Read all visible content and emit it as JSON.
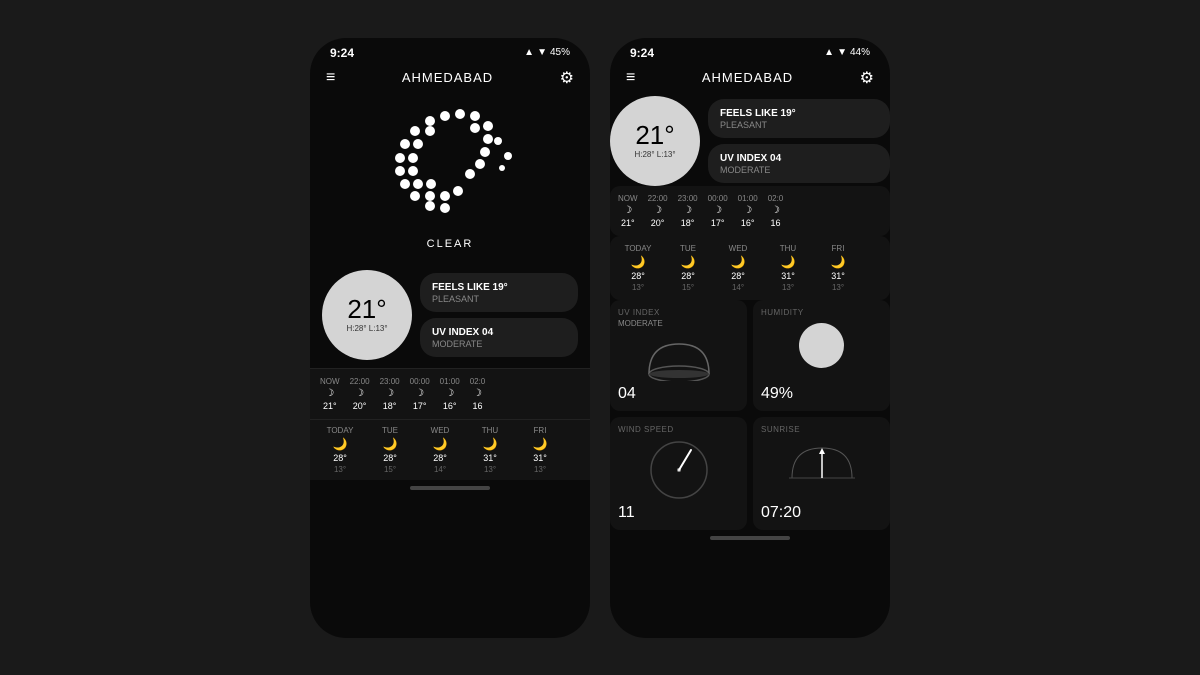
{
  "phone1": {
    "statusBar": {
      "time": "9:24",
      "battery": "45%"
    },
    "nav": {
      "title": "AHMEDABAD"
    },
    "weather": {
      "condition": "CLEAR",
      "temperature": "21°",
      "highLow": "H:28° L:13°",
      "feelsLike": "FEELS LIKE 19°",
      "feelsLikeSub": "PLEASANT",
      "uvIndex": "UV INDEX 04",
      "uvIndexSub": "MODERATE"
    },
    "hourly": [
      {
        "time": "NOW",
        "icon": "☽",
        "temp": "21°"
      },
      {
        "time": "22:00",
        "icon": "☽",
        "temp": "20°"
      },
      {
        "time": "23:00",
        "icon": "☽",
        "temp": "18°"
      },
      {
        "time": "00:00",
        "icon": "☽",
        "temp": "17°"
      },
      {
        "time": "01:00",
        "icon": "☽",
        "temp": "16°"
      },
      {
        "time": "02:0",
        "icon": "☽",
        "temp": "16"
      }
    ],
    "daily": [
      {
        "day": "TODAY",
        "icon": "🌙",
        "high": "28°",
        "low": "13°"
      },
      {
        "day": "TUE",
        "icon": "🌙",
        "high": "28°",
        "low": "15°"
      },
      {
        "day": "WED",
        "icon": "🌙",
        "high": "28°",
        "low": "14°"
      },
      {
        "day": "THU",
        "icon": "🌙",
        "high": "31°",
        "low": "13°"
      },
      {
        "day": "FRI",
        "icon": "🌙",
        "high": "31°",
        "low": "13°"
      }
    ]
  },
  "phone2": {
    "statusBar": {
      "time": "9:24",
      "battery": "44%"
    },
    "nav": {
      "title": "AHMEDABAD"
    },
    "weather": {
      "temperature": "21°",
      "highLow": "H:28° L:13°",
      "feelsLike": "FEELS LIKE 19°",
      "feelsLikeSub": "PLEASANT",
      "uvIndex": "UV INDEX 04",
      "uvIndexSub": "MODERATE"
    },
    "hourly": [
      {
        "time": "NOW",
        "icon": "☽",
        "temp": "21°"
      },
      {
        "time": "22:00",
        "icon": "☽",
        "temp": "20°"
      },
      {
        "time": "23:00",
        "icon": "☽",
        "temp": "18°"
      },
      {
        "time": "00:00",
        "icon": "☽",
        "temp": "17°"
      },
      {
        "time": "01:00",
        "icon": "☽",
        "temp": "16°"
      },
      {
        "time": "02:0",
        "icon": "☽",
        "temp": "16"
      }
    ],
    "daily": [
      {
        "day": "TODAY",
        "icon": "🌙",
        "high": "28°",
        "low": "13°"
      },
      {
        "day": "TUE",
        "icon": "🌙",
        "high": "28°",
        "low": "15°"
      },
      {
        "day": "WED",
        "icon": "🌙",
        "high": "28°",
        "low": "14°"
      },
      {
        "day": "THU",
        "icon": "🌙",
        "high": "31°",
        "low": "13°"
      },
      {
        "day": "FRI",
        "icon": "🌙",
        "high": "31°",
        "low": "13°"
      }
    ],
    "widgets": {
      "uvIndex": {
        "label": "UV INDEX",
        "sublabel": "MODERATE",
        "value": "04"
      },
      "humidity": {
        "label": "HUMIDITY",
        "value": "49",
        "unit": "%"
      },
      "windSpeed": {
        "label": "WIND SPEED",
        "value": "11"
      },
      "sunrise": {
        "label": "SUNRISE",
        "value": "07:20"
      }
    }
  }
}
